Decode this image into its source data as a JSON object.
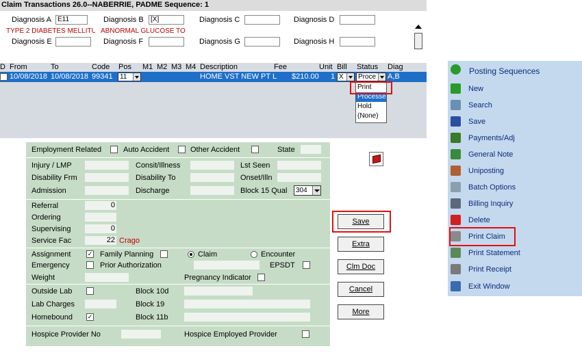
{
  "window": {
    "title": "Claim Transactions  26.0--NABERRIE, PADME   Sequence: 1"
  },
  "diagnosis": {
    "a_label": "Diagnosis A",
    "a_value": "E11",
    "a_desc": "TYPE 2 DIABETES MELLITU",
    "b_label": "Diagnosis B",
    "b_value": "[X]",
    "b_desc": "ABNORMAL GLUCOSE TO",
    "c_label": "Diagnosis C",
    "c_value": "",
    "d_label": "Diagnosis D",
    "d_value": "",
    "e_label": "Diagnosis E",
    "e_value": "",
    "f_label": "Diagnosis F",
    "f_value": "",
    "g_label": "Diagnosis G",
    "g_value": "",
    "h_label": "Diagnosis H",
    "h_value": ""
  },
  "grid": {
    "headers": {
      "d": "D",
      "from": "From",
      "to": "To",
      "code": "Code",
      "pos": "Pos",
      "m1": "M1",
      "m2": "M2",
      "m3": "M3",
      "m4": "M4",
      "description": "Description",
      "fee": "Fee",
      "unit": "Unit",
      "bill": "Bill",
      "status": "Status",
      "diag": "Diag"
    },
    "row": {
      "from": "10/08/2018",
      "to": "10/08/2018",
      "code": "99341",
      "pos": "11",
      "description": "HOME VST NEW PT L",
      "fee": "$210.00",
      "unit": "1",
      "bill": "X",
      "status": "Proce",
      "diag": "A,B"
    },
    "status_options": [
      "Print",
      "Processe",
      "Hold",
      "(None)"
    ]
  },
  "form": {
    "employment_related": "Employment Related",
    "auto_accident": "Auto Accident",
    "other_accident": "Other Accident",
    "state": "State",
    "injury_lmp": "Injury / LMP",
    "consit_illness": "Consit/Illness",
    "lst_seen": "Lst Seen",
    "disability_frm": "Disability Frm",
    "disability_to": "Disability To",
    "onset_illn": "Onset/Illn",
    "admission": "Admission",
    "discharge": "Discharge",
    "block15_qual": "Block 15 Qual",
    "block15_value": "304",
    "referral": "Referral",
    "referral_value": "0",
    "ordering": "Ordering",
    "supervising": "Supervising",
    "supervising_value": "0",
    "service_fac": "Service Fac",
    "service_fac_value": "22",
    "service_fac_name": "Crago",
    "assignment": "Assignment",
    "family_planning": "Family Planning",
    "claim": "Claim",
    "encounter": "Encounter",
    "emergency": "Emergency",
    "prior_auth": "Prior Authorization",
    "epsdt": "EPSDT",
    "weight": "Weight",
    "pregnancy": "Pregnancy Indicator",
    "outside_lab": "Outside Lab",
    "block10d": "Block 10d",
    "lab_charges": "Lab Charges",
    "block19": "Block 19",
    "homebound": "Homebound",
    "block11b": "Block 11b",
    "hospice_provider": "Hospice Provider No",
    "hospice_employed": "Hospice Employed Provider"
  },
  "buttons": {
    "save": "Save",
    "extra": "Extra",
    "clm_doc": "Clm Doc",
    "cancel": "Cancel",
    "more": "More"
  },
  "sidebar": {
    "title": "Posting Sequences",
    "items": [
      {
        "label": "New",
        "icon": "new-icon",
        "color": "#2a9a2a"
      },
      {
        "label": "Search",
        "icon": "search-icon",
        "color": "#6a8fb5"
      },
      {
        "label": "Save",
        "icon": "save-icon",
        "color": "#2a4fa0"
      },
      {
        "label": "Payments/Adj",
        "icon": "money-bag-icon",
        "color": "#3a7a2a"
      },
      {
        "label": "General Note",
        "icon": "note-icon",
        "color": "#3a8a3a"
      },
      {
        "label": "Uniposting",
        "icon": "users-icon",
        "color": "#b06030"
      },
      {
        "label": "Batch Options",
        "icon": "batch-icon",
        "color": "#8aa0b0"
      },
      {
        "label": "Billing Inquiry",
        "icon": "billing-icon",
        "color": "#5a6a7a"
      },
      {
        "label": "Delete",
        "icon": "delete-icon",
        "color": "#d02020"
      },
      {
        "label": "Print Claim",
        "icon": "printer-icon",
        "color": "#8a8a8a"
      },
      {
        "label": "Print Statement",
        "icon": "statement-icon",
        "color": "#5a8a5a"
      },
      {
        "label": "Print Receipt",
        "icon": "receipt-printer-icon",
        "color": "#7a7a7a"
      },
      {
        "label": "Exit Window",
        "icon": "exit-icon",
        "color": "#3a6ab0"
      }
    ]
  },
  "colors": {
    "highlight": "#e01010",
    "selection": "#1f6fc9",
    "form_bg": "#c6dcc6",
    "sidebar_bg": "#c4d8ee"
  }
}
